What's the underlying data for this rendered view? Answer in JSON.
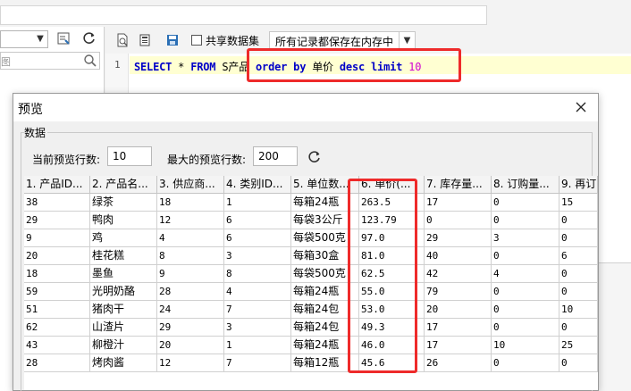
{
  "left_panel": {
    "search_placeholder": "图"
  },
  "editor_toolbar": {
    "share_label": "共享数据集",
    "mode_value": "所有记录都保存在内存中"
  },
  "editor": {
    "line_number": "1",
    "sql": {
      "select": "SELECT",
      "star": " * ",
      "from": "FROM",
      "table": " S产品 ",
      "order": "order",
      "by": " by",
      "col": " 单价 ",
      "desc": "desc",
      "limit": " limit",
      "n": " 10"
    }
  },
  "dialog": {
    "title": "预览",
    "group_label": "数据",
    "current_rows_label": "当前预览行数:",
    "current_rows_value": "10",
    "max_rows_label": "最大的预览行数:",
    "max_rows_value": "200"
  },
  "grid": {
    "columns": [
      "1. 产品ID...",
      "2. 产品名...",
      "3. 供应商...",
      "4. 类别ID...",
      "5. 单位数...",
      "6. 单价(...",
      "7. 库存量...",
      "8. 订购量...",
      "9. 再订"
    ],
    "rows": [
      [
        "38",
        "绿茶",
        "18",
        "1",
        "每箱24瓶",
        "263.5",
        "17",
        "0",
        "15"
      ],
      [
        "29",
        "鸭肉",
        "12",
        "6",
        "每袋3公斤",
        "123.79",
        "0",
        "0",
        "0"
      ],
      [
        "9",
        "鸡",
        "4",
        "6",
        "每袋500克",
        "97.0",
        "29",
        "3",
        "0"
      ],
      [
        "20",
        "桂花糕",
        "8",
        "3",
        "每箱30盒",
        "81.0",
        "40",
        "0",
        "6"
      ],
      [
        "18",
        "墨鱼",
        "9",
        "8",
        "每袋500克",
        "62.5",
        "42",
        "4",
        "0"
      ],
      [
        "59",
        "光明奶酪",
        "28",
        "4",
        "每箱24瓶",
        "55.0",
        "79",
        "0",
        "0"
      ],
      [
        "51",
        "猪肉干",
        "24",
        "7",
        "每箱24包",
        "53.0",
        "20",
        "0",
        "10"
      ],
      [
        "62",
        "山渣片",
        "29",
        "3",
        "每箱24包",
        "49.3",
        "17",
        "0",
        "0"
      ],
      [
        "43",
        "柳橙汁",
        "20",
        "1",
        "每箱24瓶",
        "46.0",
        "17",
        "10",
        "25"
      ],
      [
        "28",
        "烤肉酱",
        "12",
        "7",
        "每箱12瓶",
        "45.6",
        "26",
        "0",
        "0"
      ]
    ]
  },
  "annotation": {
    "color": "#ee2a2a"
  }
}
